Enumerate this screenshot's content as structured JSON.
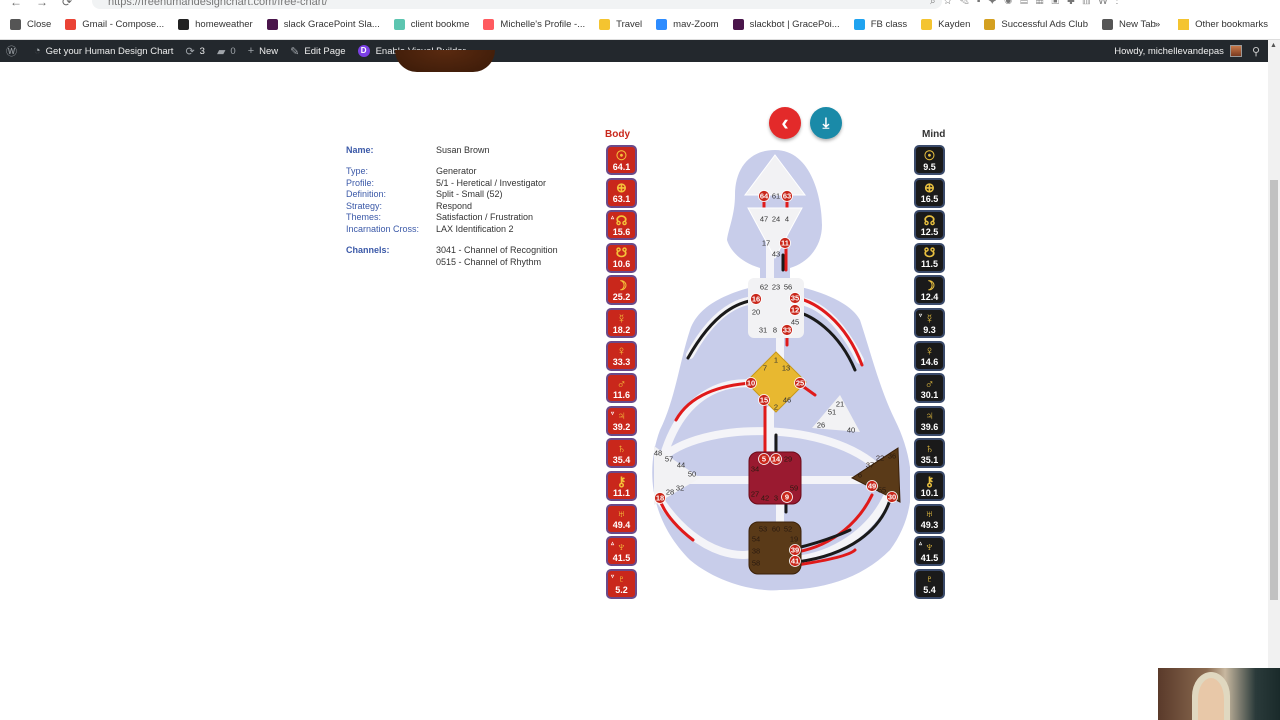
{
  "browser": {
    "url": "https://freehumandesignchart.com/free-chart/",
    "bookmarks": [
      {
        "label": "Close",
        "color": "#555"
      },
      {
        "label": "Gmail - Compose...",
        "color": "#ea4335"
      },
      {
        "label": "homeweather",
        "color": "#222"
      },
      {
        "label": "slack GracePoint Sla...",
        "color": "#4a154b"
      },
      {
        "label": "client bookme",
        "color": "#5cc5b0"
      },
      {
        "label": "Michelle's Profile -...",
        "color": "#ff5a5f"
      },
      {
        "label": "Travel",
        "color": "#f4c430"
      },
      {
        "label": "mav-Zoom",
        "color": "#2d8cff"
      },
      {
        "label": "slackbot | GracePoi...",
        "color": "#4a154b"
      },
      {
        "label": "FB class",
        "color": "#1fa3f0"
      },
      {
        "label": "Kayden",
        "color": "#f4c430"
      },
      {
        "label": "Successful Ads Club",
        "color": "#d4a020"
      },
      {
        "label": "New Tab",
        "color": "#555"
      }
    ],
    "more_bookmarks": "»",
    "other_bookmarks": "Other bookmarks"
  },
  "wpbar": {
    "site_name": "Get your Human Design Chart",
    "updates_count": "3",
    "comments_count": "0",
    "new_label": "New",
    "edit_page_label": "Edit Page",
    "visual_builder_label": "Enable Visual Builder",
    "howdy": "Howdy, michellevandepas"
  },
  "chart": {
    "name_label": "Name:",
    "name": "Susan Brown",
    "details": [
      {
        "label": "Type:",
        "value": "Generator"
      },
      {
        "label": "Profile:",
        "value": "5/1 - Heretical / Investigator"
      },
      {
        "label": "Definition:",
        "value": "Split - Small (52)"
      },
      {
        "label": "Strategy:",
        "value": "Respond"
      },
      {
        "label": "Themes:",
        "value": "Satisfaction / Frustration"
      },
      {
        "label": "Incarnation Cross:",
        "value": "LAX Identification 2"
      }
    ],
    "channels_label": "Channels:",
    "channels": [
      "3041 - Channel of Recognition",
      "0515 - Channel of Rhythm"
    ],
    "body_title": "Body",
    "mind_title": "Mind",
    "body_planets": [
      {
        "planet": "sun",
        "symbol": "☉",
        "value": "64.1",
        "arrow": ""
      },
      {
        "planet": "earth",
        "symbol": "⊕",
        "value": "63.1",
        "arrow": ""
      },
      {
        "planet": "north-node",
        "symbol": "☊",
        "value": "15.6",
        "arrow": "▵"
      },
      {
        "planet": "south-node",
        "symbol": "☋",
        "value": "10.6",
        "arrow": ""
      },
      {
        "planet": "moon",
        "symbol": "☽",
        "value": "25.2",
        "arrow": ""
      },
      {
        "planet": "mercury",
        "symbol": "☿",
        "value": "18.2",
        "arrow": ""
      },
      {
        "planet": "venus",
        "symbol": "♀",
        "value": "33.3",
        "arrow": ""
      },
      {
        "planet": "mars",
        "symbol": "♂",
        "value": "11.6",
        "arrow": ""
      },
      {
        "planet": "jupiter",
        "symbol": "♃",
        "value": "39.2",
        "arrow": "▿"
      },
      {
        "planet": "saturn",
        "symbol": "♄",
        "value": "35.4",
        "arrow": ""
      },
      {
        "planet": "chiron",
        "symbol": "⚷",
        "value": "11.1",
        "arrow": ""
      },
      {
        "planet": "uranus",
        "symbol": "♅",
        "value": "49.4",
        "arrow": ""
      },
      {
        "planet": "neptune",
        "symbol": "♆",
        "value": "41.5",
        "arrow": "▵"
      },
      {
        "planet": "pluto",
        "symbol": "♇",
        "value": "5.2",
        "arrow": "▿"
      }
    ],
    "mind_planets": [
      {
        "planet": "sun",
        "symbol": "☉",
        "value": "9.5",
        "arrow": ""
      },
      {
        "planet": "earth",
        "symbol": "⊕",
        "value": "16.5",
        "arrow": ""
      },
      {
        "planet": "north-node",
        "symbol": "☊",
        "value": "12.5",
        "arrow": ""
      },
      {
        "planet": "south-node",
        "symbol": "☋",
        "value": "11.5",
        "arrow": ""
      },
      {
        "planet": "moon",
        "symbol": "☽",
        "value": "12.4",
        "arrow": ""
      },
      {
        "planet": "mercury",
        "symbol": "☿",
        "value": "9.3",
        "arrow": "▿"
      },
      {
        "planet": "venus",
        "symbol": "♀",
        "value": "14.6",
        "arrow": ""
      },
      {
        "planet": "mars",
        "symbol": "♂",
        "value": "30.1",
        "arrow": ""
      },
      {
        "planet": "jupiter",
        "symbol": "♃",
        "value": "39.6",
        "arrow": ""
      },
      {
        "planet": "saturn",
        "symbol": "♄",
        "value": "35.1",
        "arrow": ""
      },
      {
        "planet": "chiron",
        "symbol": "⚷",
        "value": "10.1",
        "arrow": ""
      },
      {
        "planet": "uranus",
        "symbol": "♅",
        "value": "49.3",
        "arrow": ""
      },
      {
        "planet": "neptune",
        "symbol": "♆",
        "value": "41.5",
        "arrow": "▵"
      },
      {
        "planet": "pluto",
        "symbol": "♇",
        "value": "5.4",
        "arrow": ""
      }
    ],
    "back_icon": "‹",
    "download_icon": "⤓",
    "gates": {
      "head": [
        "64",
        "61",
        "63"
      ],
      "ajna": [
        "47",
        "24",
        "4",
        "17",
        "43",
        "11"
      ],
      "throat": [
        "62",
        "23",
        "56",
        "16",
        "35",
        "20",
        "12",
        "45",
        "31",
        "8",
        "33"
      ],
      "g": [
        "1",
        "7",
        "13",
        "10",
        "25",
        "15",
        "2",
        "46"
      ],
      "ego": [
        "21",
        "51",
        "26",
        "40"
      ],
      "spleen": [
        "48",
        "57",
        "44",
        "50",
        "32",
        "28",
        "18"
      ],
      "sacral": [
        "5",
        "14",
        "29",
        "34",
        "27",
        "42",
        "3",
        "9",
        "59"
      ],
      "solar_plexus": [
        "22",
        "36",
        "37",
        "6",
        "49",
        "55",
        "30"
      ],
      "root": [
        "53",
        "60",
        "52",
        "54",
        "19",
        "38",
        "39",
        "58",
        "41"
      ]
    },
    "active_gates": [
      "64",
      "63",
      "11",
      "16",
      "35",
      "12",
      "33",
      "10",
      "25",
      "15",
      "18",
      "5",
      "14",
      "9",
      "49",
      "30",
      "39",
      "41"
    ],
    "colors": {
      "body_red": "#c9271b",
      "mind_black": "#1a1a1a",
      "silhouette": "#c8cdea",
      "g_center": "#e8b830",
      "sacral": "#9a1a30",
      "root": "#5a3a18",
      "solar_plexus": "#5a3a18"
    }
  }
}
